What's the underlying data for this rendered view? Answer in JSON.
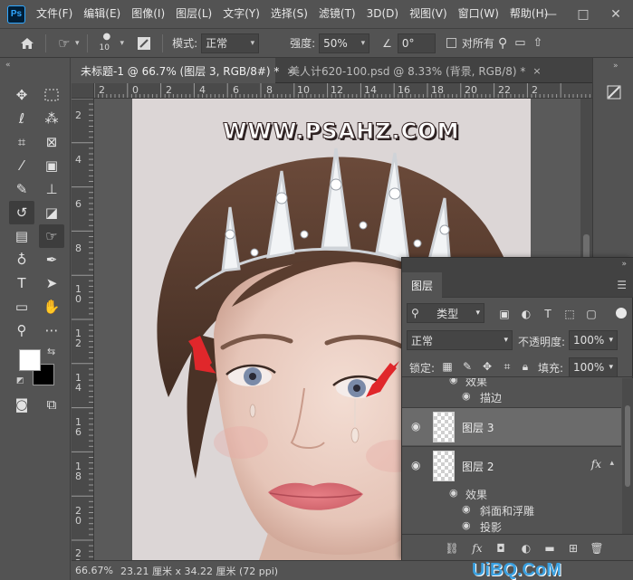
{
  "app": {
    "logo_text": "Ps"
  },
  "menubar": {
    "items": [
      "文件(F)",
      "编辑(E)",
      "图像(I)",
      "图层(L)",
      "文字(Y)",
      "选择(S)",
      "滤镜(T)",
      "3D(D)",
      "视图(V)",
      "窗口(W)",
      "帮助(H)"
    ],
    "window_controls": {
      "minimize": "—",
      "maximize": "□",
      "close": "✕"
    }
  },
  "options": {
    "brush_size": "10",
    "mode_label": "模式:",
    "mode_value": "正常",
    "strength_label": "强度:",
    "strength_value": "50%",
    "angle_value": "0°",
    "sample_all_label": "对所有"
  },
  "tabs": [
    {
      "label": "未标题-1 @ 66.7% (图层 3, RGB/8#) *",
      "close": "×"
    },
    {
      "label": "美人计620-100.psd @ 8.33% (背景, RGB/8) *",
      "close": "×"
    }
  ],
  "rulers": {
    "top": [
      "2",
      "0",
      "2",
      "4",
      "6",
      "8",
      "10",
      "12",
      "14",
      "16",
      "18",
      "20",
      "22",
      "2"
    ],
    "left": [
      "2",
      "4",
      "6",
      "8",
      "1\n0",
      "1\n2",
      "1\n4",
      "1\n6",
      "1\n8",
      "2\n0",
      "2\n2"
    ]
  },
  "canvas": {
    "watermark": "WWW.PSAHZ.COM",
    "bg_color": "#dcd6d6"
  },
  "status": {
    "zoom": "66.67%",
    "doc_size": "23.21 厘米 x 34.22 厘米 (72 ppi)"
  },
  "layers_panel": {
    "tab": "图层",
    "filter_kind": "类型",
    "blend_mode": "正常",
    "opacity_label": "不透明度:",
    "opacity_value": "100%",
    "lock_label": "锁定:",
    "fill_label": "填充:",
    "fill_value": "100%",
    "effects_top": [
      {
        "label": "效果"
      },
      {
        "label": "描边"
      }
    ],
    "layers": [
      {
        "name": "图层 3",
        "selected": true,
        "fx": ""
      },
      {
        "name": "图层 2",
        "selected": false,
        "fx": "fx"
      }
    ],
    "effects_bottom": [
      {
        "label": "效果"
      },
      {
        "label": "斜面和浮雕"
      },
      {
        "label": "投影"
      }
    ]
  },
  "corner_logo": "UiBQ.CoM"
}
